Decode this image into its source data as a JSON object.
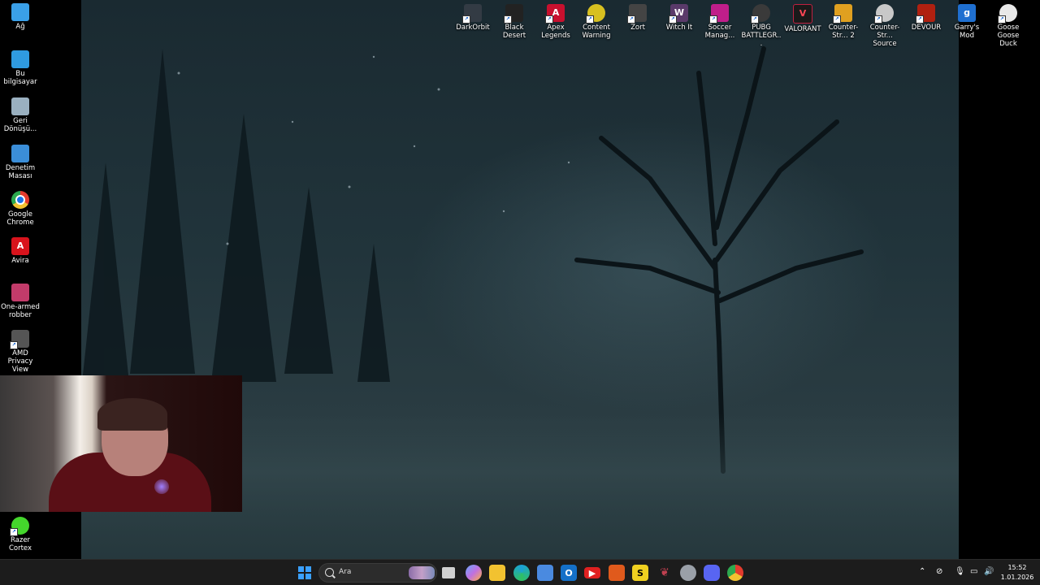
{
  "desktop": {
    "left_icons": [
      {
        "label": "Ağ",
        "icon": "network-icon",
        "color": "#3aa0e8"
      },
      {
        "label": "Bu bilgisayar",
        "icon": "computer-icon",
        "color": "#2f9be0"
      },
      {
        "label": "Geri Dönüşü...",
        "icon": "recycle-bin-icon",
        "color": "#9ab0c0"
      },
      {
        "label": "Denetim Masası",
        "icon": "control-panel-icon",
        "color": "#3b8ed8"
      },
      {
        "label": "Google Chrome",
        "icon": "chrome-icon",
        "color": "#e8b400"
      },
      {
        "label": "Avira",
        "icon": "avira-icon",
        "color": "#d8131c"
      },
      {
        "label": "One-armed robber",
        "icon": "slot-machine-icon",
        "color": "#c23b6a"
      },
      {
        "label": "AMD Privacy View",
        "icon": "amd-privacy-icon",
        "color": "#555555"
      },
      {
        "label": "Razer Cortex",
        "icon": "razer-cortex-icon",
        "color": "#44d62c"
      }
    ],
    "top_icons": [
      {
        "label": "DarkOrbit",
        "icon": "darkorbit-icon",
        "color": "#333b44"
      },
      {
        "label": "Black Desert",
        "icon": "black-desert-icon",
        "color": "#222222"
      },
      {
        "label": "Apex Legends",
        "icon": "apex-icon",
        "color": "#c8102e"
      },
      {
        "label": "Content Warning",
        "icon": "content-warning-icon",
        "color": "#d8c020"
      },
      {
        "label": "Zort",
        "icon": "zort-icon",
        "color": "#444444"
      },
      {
        "label": "Witch It",
        "icon": "witch-it-icon",
        "color": "#5a3a6a"
      },
      {
        "label": "Soccer Manag...",
        "icon": "soccer-manager-icon",
        "color": "#c01e8a"
      },
      {
        "label": "PUBG BATTLEGR...",
        "icon": "pubg-icon",
        "color": "#3a3a3a"
      },
      {
        "label": "VALORANT",
        "icon": "valorant-icon",
        "color": "#1a1a1a"
      },
      {
        "label": "Counter-Str... 2",
        "icon": "cs2-icon",
        "color": "#e0a020"
      },
      {
        "label": "Counter-Str... Source",
        "icon": "css-icon",
        "color": "#c8c8c8"
      },
      {
        "label": "DEVOUR",
        "icon": "devour-icon",
        "color": "#b02010"
      },
      {
        "label": "Garry's Mod",
        "icon": "garrys-mod-icon",
        "color": "#1f6fd0"
      },
      {
        "label": "Goose Goose Duck",
        "icon": "goose-goose-duck-icon",
        "color": "#e8e8e8"
      }
    ]
  },
  "taskbar": {
    "search_label": "Ara",
    "apps": [
      {
        "icon": "start-icon",
        "color": "#3aa0ff"
      },
      {
        "icon": "task-view-icon",
        "color": "#d0d0d0"
      },
      {
        "icon": "copilot-icon",
        "color": "#6aa8ff"
      },
      {
        "icon": "file-explorer-icon",
        "color": "#f2c230"
      },
      {
        "icon": "edge-icon",
        "color": "#1aa0d8"
      },
      {
        "icon": "store-icon",
        "color": "#4a8ae0"
      },
      {
        "icon": "outlook-icon",
        "color": "#1470c8"
      },
      {
        "icon": "youtube-icon",
        "color": "#e02020"
      },
      {
        "icon": "office-icon",
        "color": "#e05a1c"
      },
      {
        "icon": "s-app-icon",
        "color": "#f0d020"
      },
      {
        "icon": "feather-app-icon",
        "color": "#c04050"
      },
      {
        "icon": "steam-helper-icon",
        "color": "#9aa0a8"
      },
      {
        "icon": "discord-icon",
        "color": "#5865f2"
      },
      {
        "icon": "chrome-icon",
        "color": "#e8b400"
      }
    ],
    "tray": {
      "time": "15:52",
      "date": "1.01.2026"
    }
  }
}
